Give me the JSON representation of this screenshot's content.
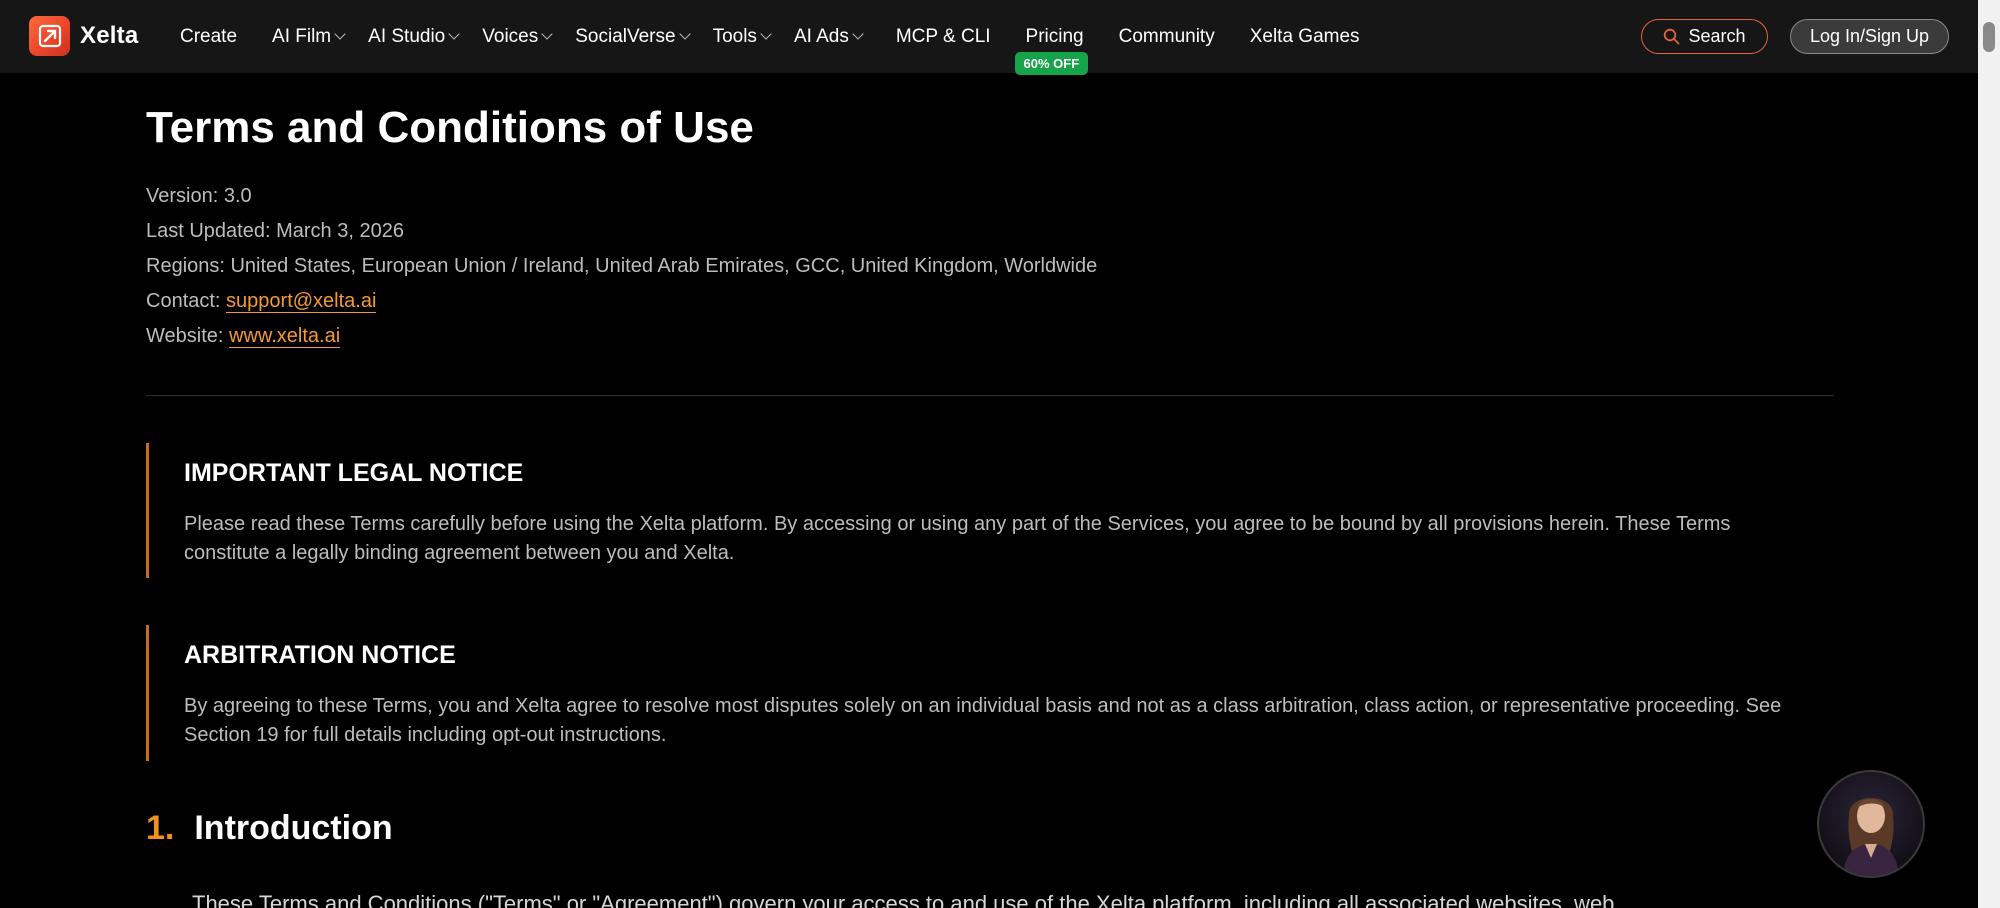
{
  "nav": {
    "brand": "Xelta",
    "items": [
      {
        "label": "Create",
        "dropdown": false
      },
      {
        "label": "AI Film",
        "dropdown": true
      },
      {
        "label": "AI Studio",
        "dropdown": true
      },
      {
        "label": "Voices",
        "dropdown": true
      },
      {
        "label": "SocialVerse",
        "dropdown": true
      },
      {
        "label": "Tools",
        "dropdown": true
      },
      {
        "label": "AI Ads",
        "dropdown": true
      },
      {
        "label": "MCP & CLI",
        "dropdown": false
      },
      {
        "label": "Pricing",
        "dropdown": false,
        "badge": "60% OFF"
      },
      {
        "label": "Community",
        "dropdown": false
      },
      {
        "label": "Xelta Games",
        "dropdown": false
      }
    ],
    "search_label": "Search",
    "login_label": "Log In/Sign Up"
  },
  "doc": {
    "title": "Terms and Conditions of Use",
    "version": "Version: 3.0",
    "last_updated": "Last Updated: March 3, 2026",
    "regions": "Regions: United States, European Union / Ireland, United Arab Emirates, GCC, United Kingdom, Worldwide",
    "contact_label": "Contact: ",
    "contact_email": "support@xelta.ai",
    "website_label": "Website: ",
    "website_url": "www.xelta.ai",
    "notices": [
      {
        "title": "IMPORTANT LEGAL NOTICE",
        "body": "Please read these Terms carefully before using the Xelta platform. By accessing or using any part of the Services, you agree to be bound by all provisions herein. These Terms constitute a legally binding agreement between you and Xelta."
      },
      {
        "title": "ARBITRATION NOTICE",
        "body": "By agreeing to these Terms, you and Xelta agree to resolve most disputes solely on an individual basis and not as a class arbitration, class action, or representative proceeding. See Section 19 for full details including opt-out instructions."
      }
    ],
    "section1": {
      "number": "1.",
      "title": "Introduction",
      "text": "These Terms and Conditions (\"Terms\" or \"Agreement\") govern your access to and use of the Xelta platform, including all associated websites, web"
    }
  },
  "colors": {
    "accent": "#f2911f",
    "link": "#f29a3a",
    "badge": "#17a34a",
    "nav_bg": "#161616"
  }
}
